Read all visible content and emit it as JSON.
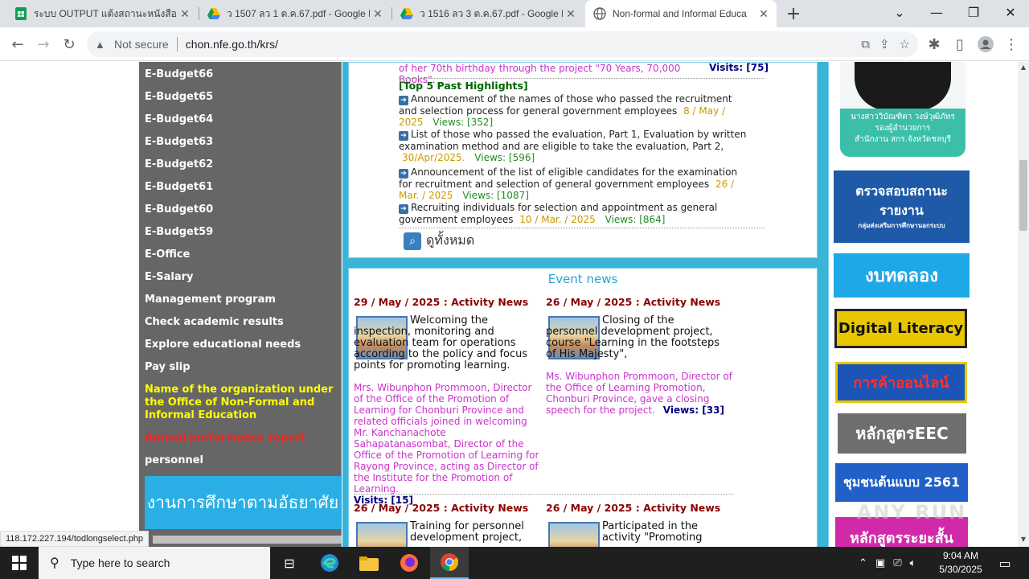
{
  "tabs": [
    {
      "title": "ระบบ OUTPUT แต้งสถานะหนังสือ/ราย",
      "icon": "sheets-icon"
    },
    {
      "title": "ว 1507 ลว 1 ต.ค.67.pdf - Google D",
      "icon": "drive-icon"
    },
    {
      "title": "ว 1516 ลว 3 ต.ค.67.pdf - Google D",
      "icon": "drive-icon"
    },
    {
      "title": "Non-formal and Informal Educa",
      "icon": "globe-icon"
    }
  ],
  "address": {
    "security": "Not secure",
    "url": "chon.nfe.go.th/krs/"
  },
  "sidebar": {
    "items": [
      {
        "label": "E-Budget66"
      },
      {
        "label": "E-Budget65"
      },
      {
        "label": "E-Budget64"
      },
      {
        "label": "E-Budget63"
      },
      {
        "label": "E-Budget62"
      },
      {
        "label": "E-Budget61"
      },
      {
        "label": "E-Budget60"
      },
      {
        "label": "E-Budget59"
      },
      {
        "label": "E-Office"
      },
      {
        "label": "E-Salary"
      },
      {
        "label": "Management program"
      },
      {
        "label": "Check academic results"
      },
      {
        "label": "Explore educational needs"
      },
      {
        "label": "Pay slip"
      },
      {
        "label": "Name of the organization under the Office of Non-Formal and Informal Education"
      },
      {
        "label": "Annual performance report"
      },
      {
        "label": "personnel"
      }
    ],
    "banner": "งานการศึกษาตามอัธยาศัย"
  },
  "highlights": {
    "top_line": "of her 70th birthday through the project \"70 Years, 70,000 Books\".",
    "top_views": "Visits: [75]",
    "heading": "[Top 5 Past Highlights]",
    "items": [
      {
        "text": "Announcement of the names of those who passed the recruitment and selection process for general government employees",
        "date": "8 / May / 2025",
        "views": "Views: [352]"
      },
      {
        "text": "List of those who passed the evaluation, Part 1, Evaluation by written examination method and are eligible to take the evaluation, Part 2,",
        "date": "30/Apr/2025.",
        "views": "Views: [596]"
      },
      {
        "text": "Announcement of the list of eligible candidates for the examination for recruitment and selection of general government employees",
        "date": "26 / Mar. / 2025",
        "views": "Views: [1087]"
      },
      {
        "text": "Recruiting individuals for selection and appointment as general government employees",
        "date": "10 / Mar. / 2025",
        "views": "Views: [864]"
      }
    ],
    "view_all": "ดูทั้งหมด"
  },
  "events": {
    "title": "Event news",
    "items": [
      {
        "date": "29 / May / 2025 : Activity News",
        "headline": "Welcoming the inspection, monitoring and evaluation team for operations according to the policy and focus points for promoting learning.",
        "body": "Mrs. Wibunphon Prommoon, Director of the Office of the Promotion of Learning for Chonburi Province and related officials joined in welcoming Mr. Kanchanachote Sahapatanasombat, Director of the Office of the Promotion of Learning for Rayong Province, acting as Director of the Institute for the Promotion of Learning.",
        "visits": "Visits: [15]"
      },
      {
        "date": "26 / May / 2025 : Activity News",
        "headline": "Closing of the personnel development project, course \"Learning in the footsteps of His Majesty\",",
        "body": "Ms. Wibunphon Prommoon, Director of the Office of Learning Promotion, Chonburi Province, gave a closing speech for the project.",
        "visits": "Views: [33]"
      },
      {
        "date": "26 / May / 2025 : Activity News",
        "headline": "Training for personnel development project,",
        "body": "",
        "visits": ""
      },
      {
        "date": "26 / May / 2025 : Activity News",
        "headline": "Participated in the activity \"Promoting",
        "body": "",
        "visits": ""
      }
    ]
  },
  "right_banners": {
    "portrait_caption": [
      "นางสาววิบัณฑิตา วงษ์วุฒิภัทร",
      "รองผู้อำนวยการ",
      "สำนักงาน สกร.จังหวัดชลบุรี"
    ],
    "check_status": [
      "ตรวจสอบสถานะ",
      "รายงาน",
      "กลุ่มส่งเสริมการศึกษานอกระบบ"
    ],
    "trial": "งบทดลอง",
    "digital_literacy": "Digital Literacy",
    "online_trade": "การค้าออนไลน์",
    "eec": "หลักสูตรEEC",
    "model_community": "ชุมชนต้นแบบ 2561",
    "short_course": "หลักสูตรระยะสั้น",
    "watermark": "ANY RUN"
  },
  "status_url": "118.172.227.194/todlongselect.php",
  "taskbar": {
    "search_placeholder": "Type here to search",
    "time": "9:04 AM",
    "date": "5/30/2025"
  }
}
